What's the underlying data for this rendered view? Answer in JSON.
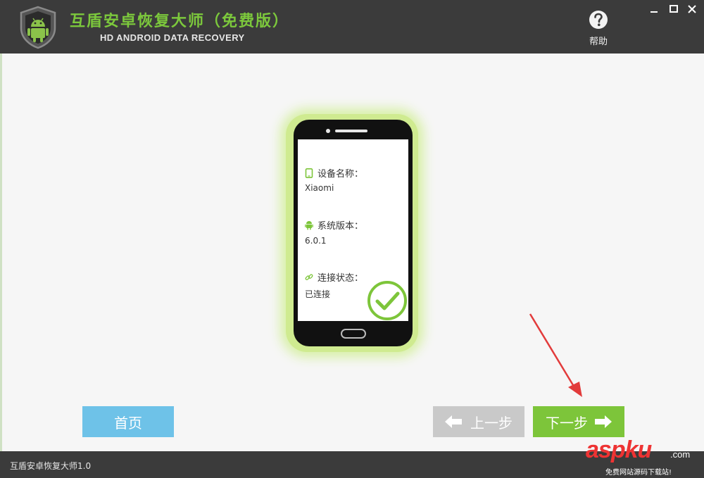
{
  "titlebar": {
    "title": "互盾安卓恢复大师（免费版）",
    "subtitle": "HD ANDROID DATA RECOVERY",
    "help_label": "帮助",
    "logo_icon": "android-shield-icon",
    "window_controls": [
      "minimize-icon",
      "maximize-icon",
      "close-icon"
    ]
  },
  "device": {
    "name_label": "设备名称：",
    "name_value": "Xiaomi",
    "version_label": "系统版本：",
    "version_value": "6.0.1",
    "status_label": "连接状态：",
    "status_value": "已连接",
    "status_icon": "checkmark-circle-icon"
  },
  "buttons": {
    "home": "首页",
    "prev": "上一步",
    "next": "下一步"
  },
  "statusbar": {
    "text": "互盾安卓恢复大师1.0"
  },
  "watermark": {
    "brand_a": "asp",
    "brand_b": "ku",
    "dotcom": ".com",
    "tagline": "免费网站源码下载站!"
  },
  "colors": {
    "accent_green": "#7dc53a",
    "title_green": "#7cc83c",
    "home_blue": "#6ec2e8",
    "disabled_gray": "#c9c9c9",
    "chrome_dark": "#3b3b3b",
    "annotation_red": "#e23b3b"
  }
}
